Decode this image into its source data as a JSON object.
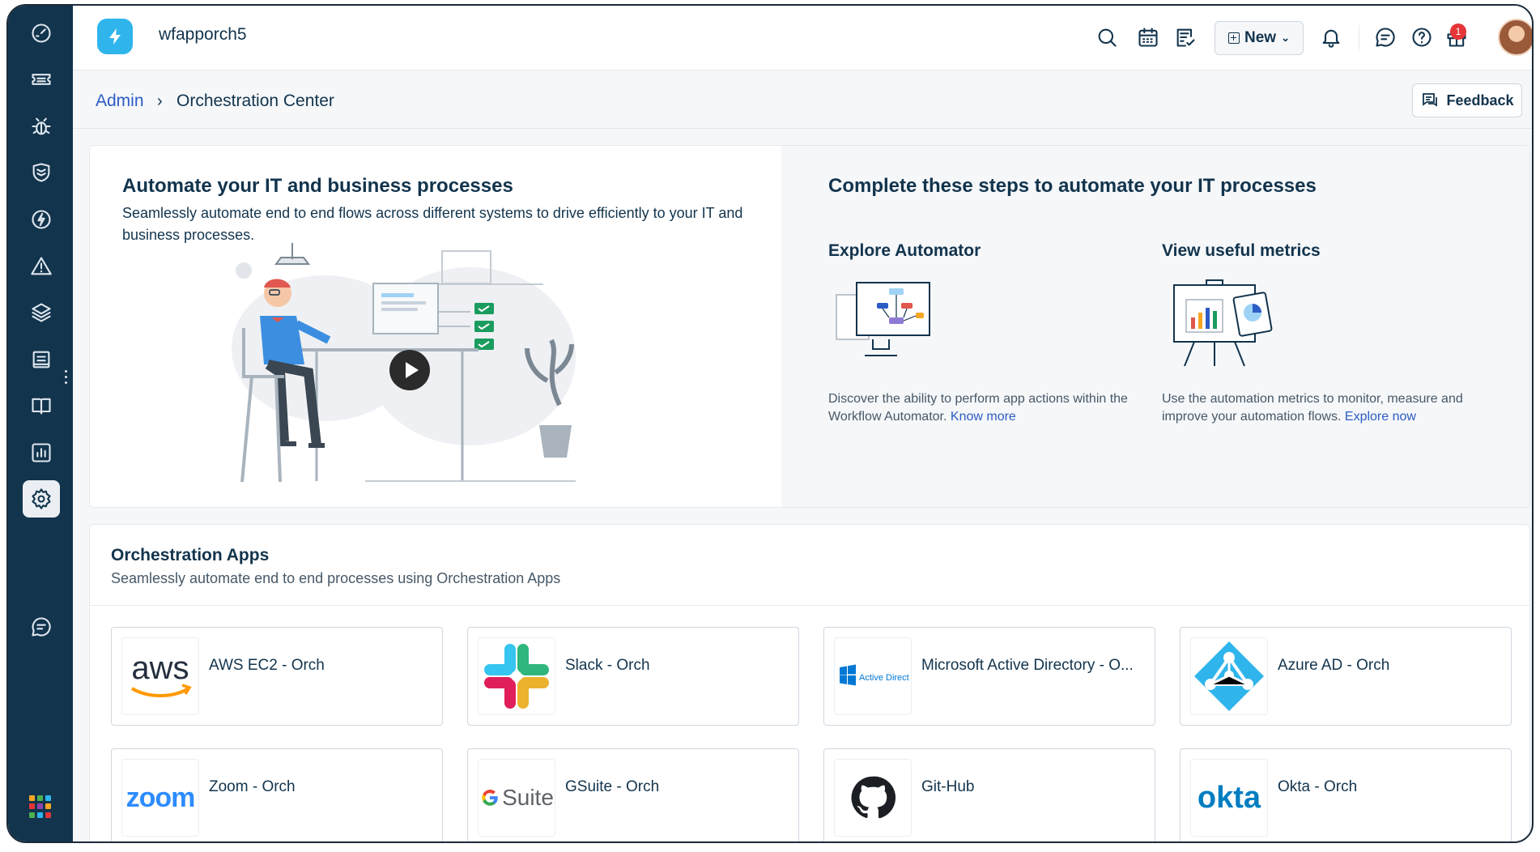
{
  "header": {
    "workspace_name": "wfapporch5",
    "new_label": "New",
    "notification_count": "1"
  },
  "breadcrumb": {
    "admin": "Admin",
    "separator": "›",
    "current": "Orchestration Center"
  },
  "feedback_label": "Feedback",
  "hero": {
    "title": "Automate your IT and business processes",
    "description": "Seamlessly automate end to end flows across different systems to drive efficiently to your IT and business processes."
  },
  "steps": {
    "title": "Complete these steps to automate your IT processes",
    "explore": {
      "title": "Explore Automator",
      "description": "Discover the ability to perform app actions within the Workflow Automator.",
      "link": "Know more"
    },
    "metrics": {
      "title": "View useful metrics",
      "description": "Use the automation metrics to monitor, measure and improve your automation flows.",
      "link": "Explore now"
    }
  },
  "apps": {
    "title": "Orchestration Apps",
    "description": "Seamlessly automate end to end processes using Orchestration Apps",
    "items": [
      {
        "name": "AWS EC2 - Orch",
        "logo_text": "aws"
      },
      {
        "name": "Slack - Orch"
      },
      {
        "name": "Microsoft Active Directory - O...",
        "logo_text": "Active Directory"
      },
      {
        "name": "Azure AD - Orch"
      },
      {
        "name": "Zoom - Orch",
        "logo_text": "zoom"
      },
      {
        "name": "GSuite - Orch",
        "logo_text": "Suite"
      },
      {
        "name": "Git-Hub"
      },
      {
        "name": "Okta - Orch",
        "logo_text": "okta"
      }
    ]
  },
  "colors": {
    "sidebar": "#12344d",
    "link": "#2c5cc5",
    "brand": "#2fb5ec",
    "badge": "#e43538"
  },
  "icons": [
    "dashboard-icon",
    "tickets-icon",
    "problems-icon",
    "changes-icon",
    "releases-icon",
    "alerts-icon",
    "assets-icon",
    "projects-icon",
    "solutions-icon",
    "reports-icon",
    "admin-icon",
    "chat-icon",
    "apps-grid-icon",
    "search-icon",
    "calendar-icon",
    "todo-icon",
    "bell-icon",
    "message-icon",
    "help-icon",
    "gift-icon"
  ]
}
